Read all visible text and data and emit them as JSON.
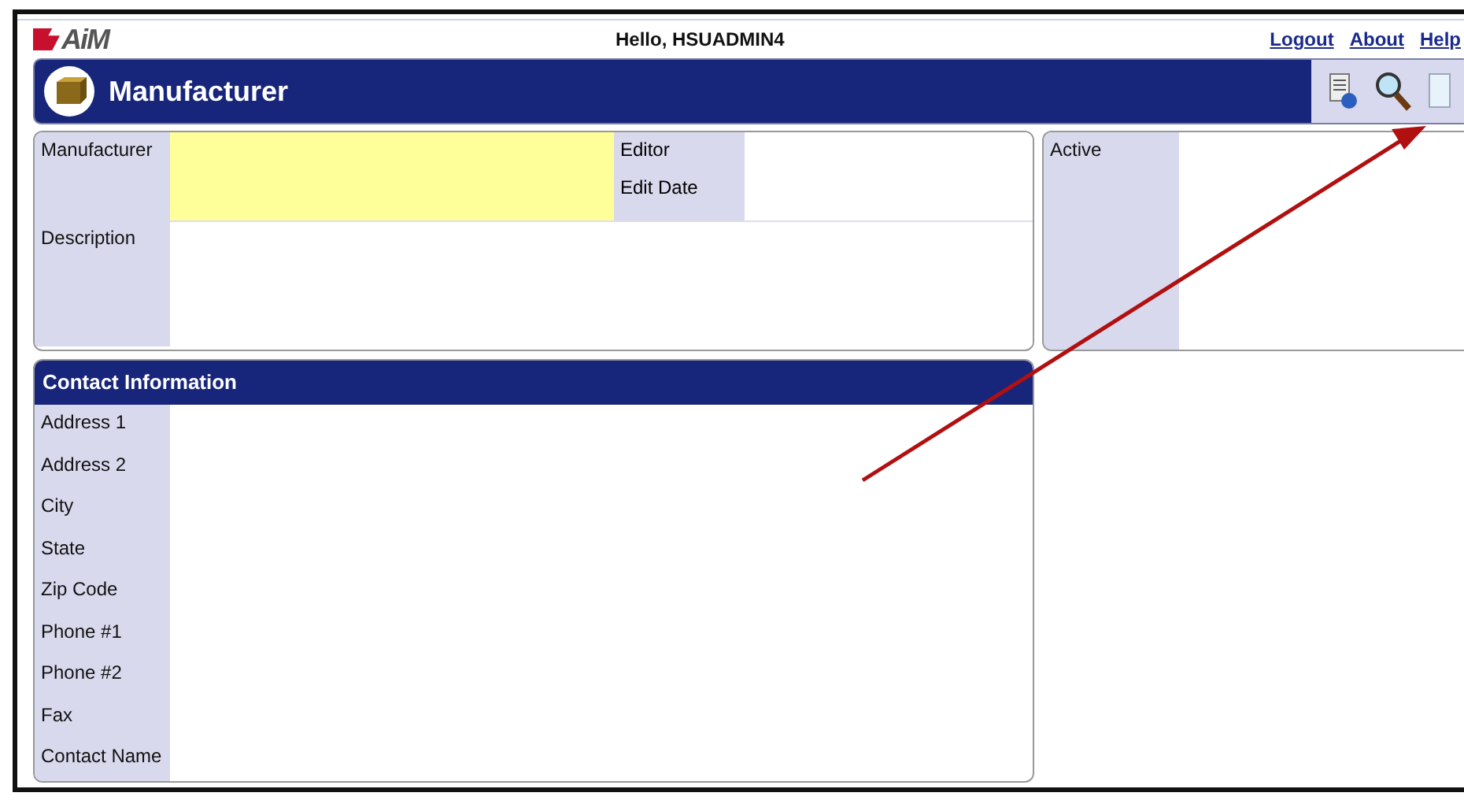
{
  "header": {
    "logo": "AiM",
    "greeting": "Hello, HSUADMIN4",
    "links": [
      "Logout",
      "About",
      "Help"
    ]
  },
  "title_bar": {
    "title": "Manufacturer"
  },
  "record": {
    "main_fields": [
      {
        "label": "Manufacturer",
        "required": true
      },
      {
        "label": "Description",
        "required": false
      }
    ],
    "side_fields": [
      "Editor",
      "Edit Date"
    ]
  },
  "status_panel": {
    "label": "Active"
  },
  "contact": {
    "title": "Contact Information",
    "fields": [
      "Address 1",
      "Address 2",
      "City",
      "State",
      "Zip Code",
      "Phone #1",
      "Phone #2",
      "Fax",
      "Contact Name"
    ]
  }
}
